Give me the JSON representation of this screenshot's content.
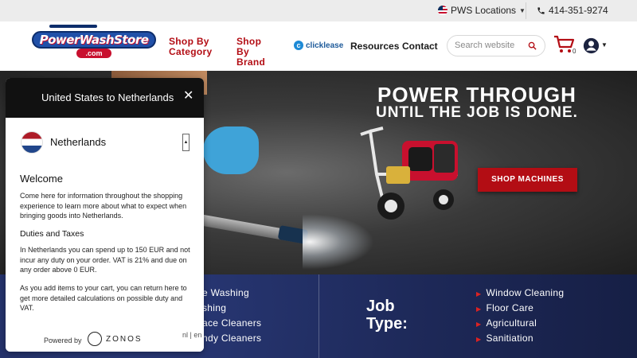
{
  "topbar": {
    "locations_label": "PWS Locations",
    "phone": "414-351-9274"
  },
  "header": {
    "logo_text": "PowerWashStore",
    "logo_subtext": ".com",
    "nav": {
      "shop_by_category": "Shop By Category",
      "shop_by_brand": "Shop By Brand",
      "clicklease": "clicklease",
      "resources": "Resources",
      "contact": "Contact"
    },
    "search_placeholder": "Search website",
    "cart_count": "0"
  },
  "hero": {
    "title_line1": "POWER THROUGH",
    "title_line2": "UNTIL THE JOB IS DONE.",
    "cta_label": "SHOP MACHINES"
  },
  "categories": {
    "left_items": [
      "e Washing",
      "shing",
      "ace Cleaners",
      "ndy Cleaners"
    ],
    "job_type_label_line1": "Job",
    "job_type_label_line2": "Type:",
    "job_types": [
      "Window Cleaning",
      "Floor Care",
      "Agricultural",
      "Sanitiation"
    ]
  },
  "popup": {
    "title": "United States to Netherlands",
    "country": "Netherlands",
    "welcome_heading": "Welcome",
    "welcome_text": "Come here for information throughout the shopping experience to learn more about what to expect when bringing goods into Netherlands.",
    "duties_heading": "Duties and Taxes",
    "duties_text": "In Netherlands you can spend up to 150 EUR and not incur any duty on your order. VAT is 21% and due on any order above 0 EUR.",
    "cart_text": "As you add items to your cart, you can return here to get more detailed calculations on possible duty and VAT.",
    "powered_by": "Powered by",
    "brand": "ZONOS",
    "languages": "nl | en"
  },
  "colors": {
    "accent_red": "#b30d14",
    "band_navy": "#1d2857",
    "brand_blue": "#2150a8"
  }
}
